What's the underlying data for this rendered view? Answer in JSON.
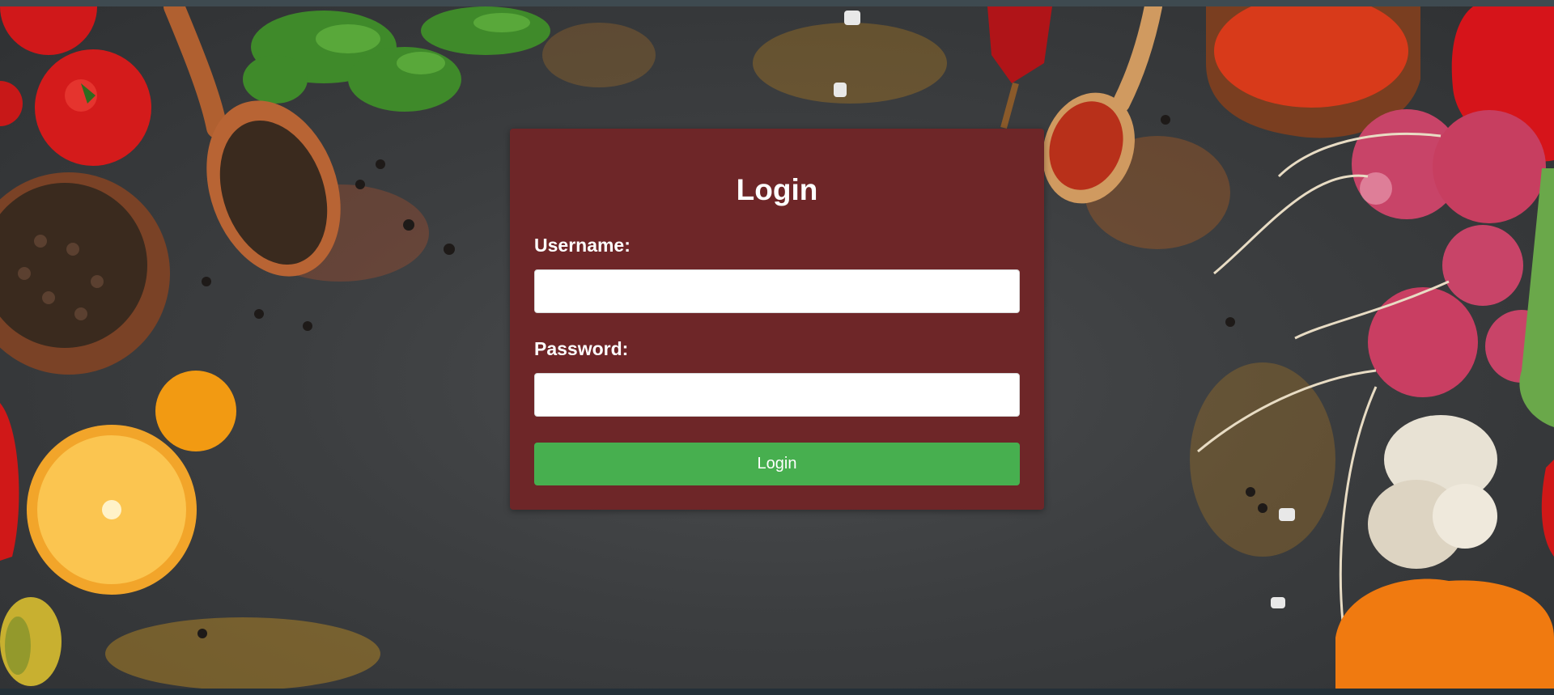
{
  "login": {
    "title": "Login",
    "username_label": "Username:",
    "password_label": "Password:",
    "username_value": "",
    "password_value": "",
    "button_label": "Login"
  },
  "colors": {
    "card": "#6e2628",
    "button": "#47af4f",
    "text": "#ffffff",
    "background": "#3a3c3e"
  }
}
